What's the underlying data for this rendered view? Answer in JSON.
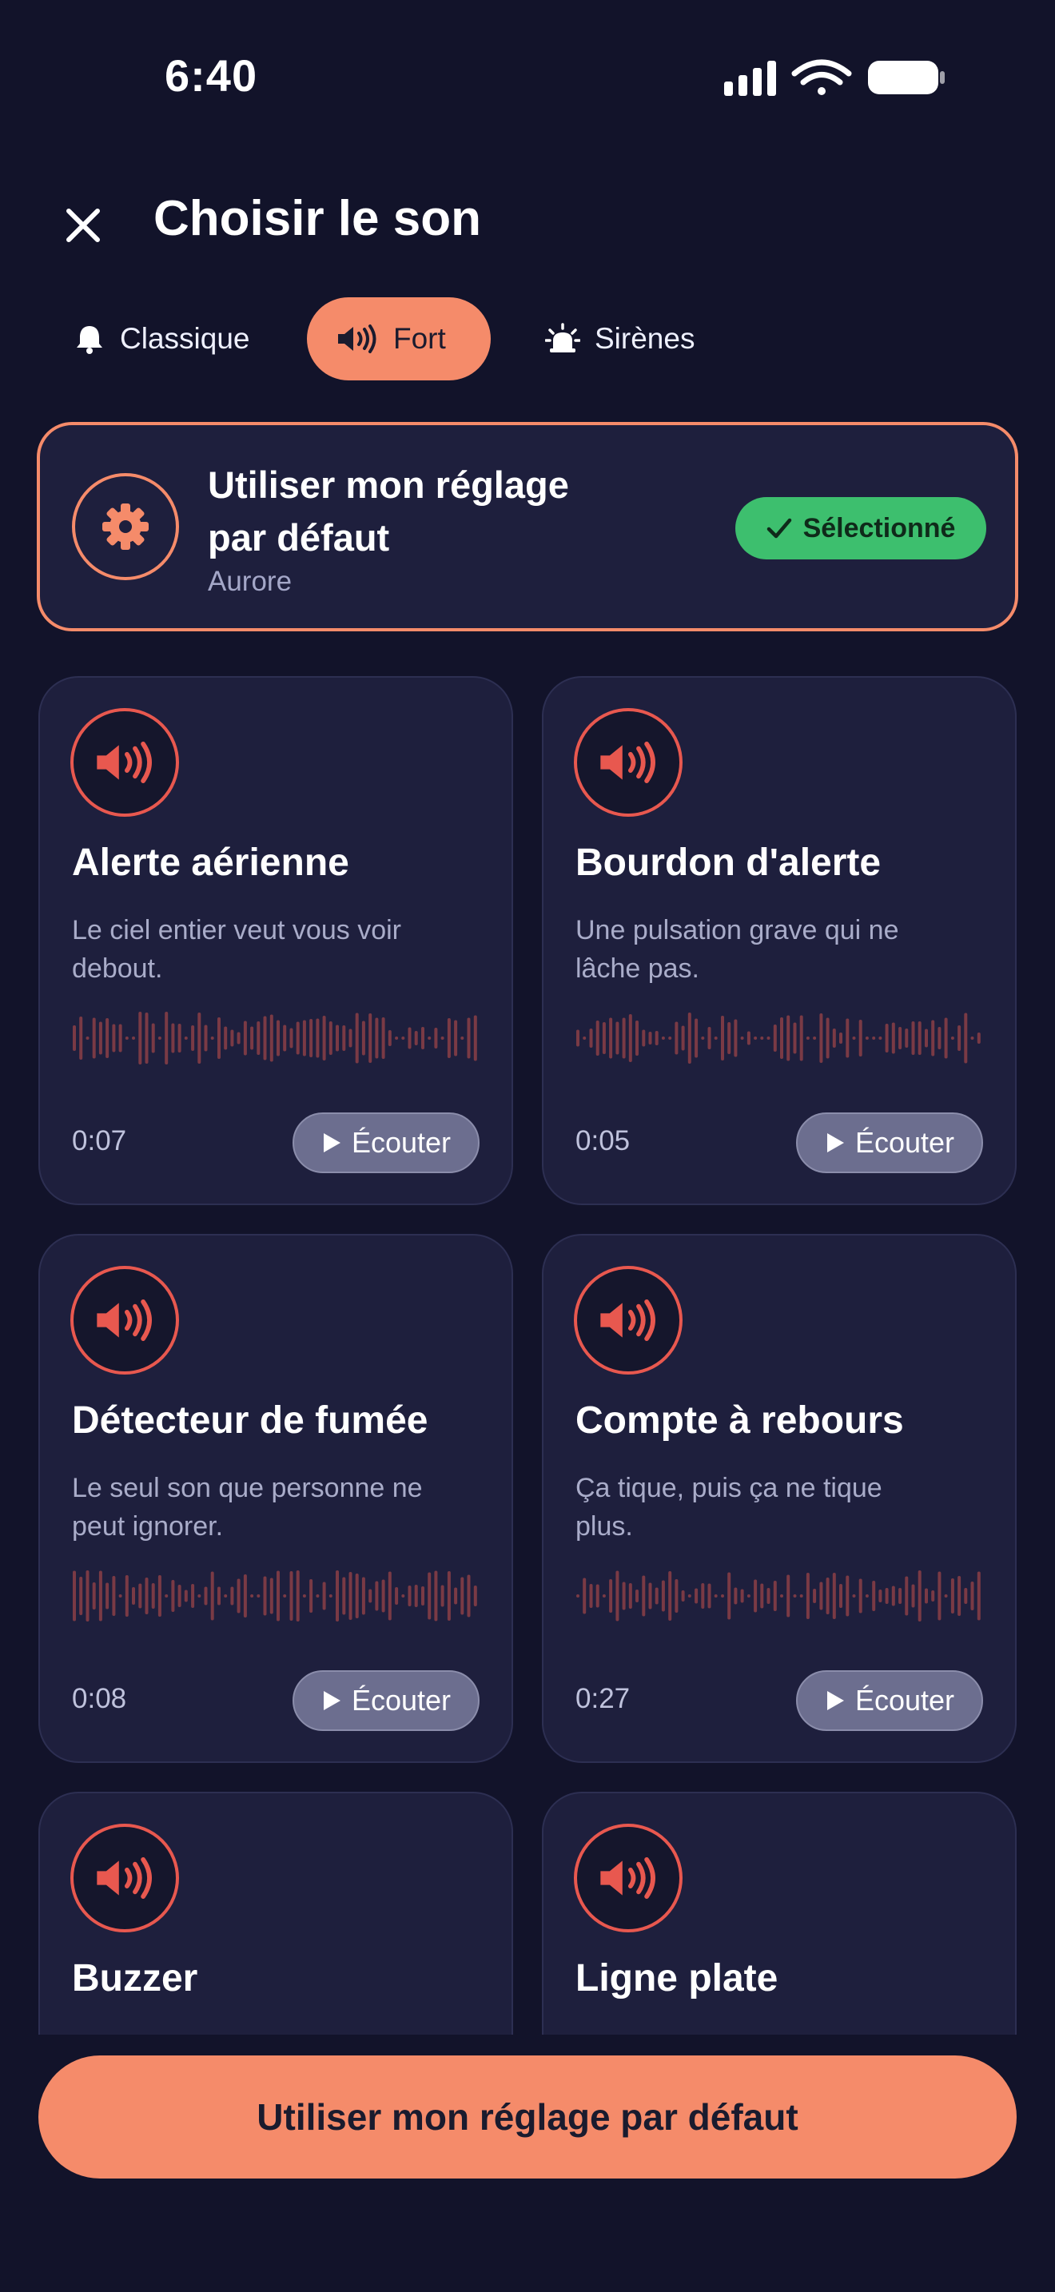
{
  "status_bar": {
    "time": "6:40"
  },
  "header": {
    "title": "Choisir le son"
  },
  "tabs": [
    {
      "label": "Classique",
      "icon": "bell-icon",
      "active": false
    },
    {
      "label": "Fort",
      "icon": "speaker-loud-icon",
      "active": true
    },
    {
      "label": "Sirènes",
      "icon": "siren-icon",
      "active": false
    }
  ],
  "default_setting": {
    "title": "Utiliser mon réglage par défaut",
    "subtitle": "Aurore",
    "badge": "Sélectionné",
    "icon": "gear-icon"
  },
  "sounds": [
    {
      "name": "Alerte aérienne",
      "description": "Le ciel entier veut vous voir debout.",
      "duration": "0:07",
      "action": "Écouter"
    },
    {
      "name": "Bourdon d'alerte",
      "description": "Une pulsation grave qui ne lâche pas.",
      "duration": "0:05",
      "action": "Écouter"
    },
    {
      "name": "Détecteur de fumée",
      "description": "Le seul son que personne ne peut ignorer.",
      "duration": "0:08",
      "action": "Écouter"
    },
    {
      "name": "Compte à rebours",
      "description": "Ça tique, puis ça ne tique plus.",
      "duration": "0:27",
      "action": "Écouter"
    },
    {
      "name": "Buzzer",
      "description": "",
      "duration": "",
      "action": ""
    },
    {
      "name": "Ligne plate",
      "description": "",
      "duration": "",
      "action": ""
    }
  ],
  "bottom_button": {
    "label": "Utiliser mon réglage par défaut"
  },
  "colors": {
    "background": "#12132a",
    "card": "#1e1f3d",
    "accent": "#f58b6a",
    "icon_red": "#e8584f",
    "selected_green": "#3dbf6e",
    "wave": "#7a3a45"
  }
}
